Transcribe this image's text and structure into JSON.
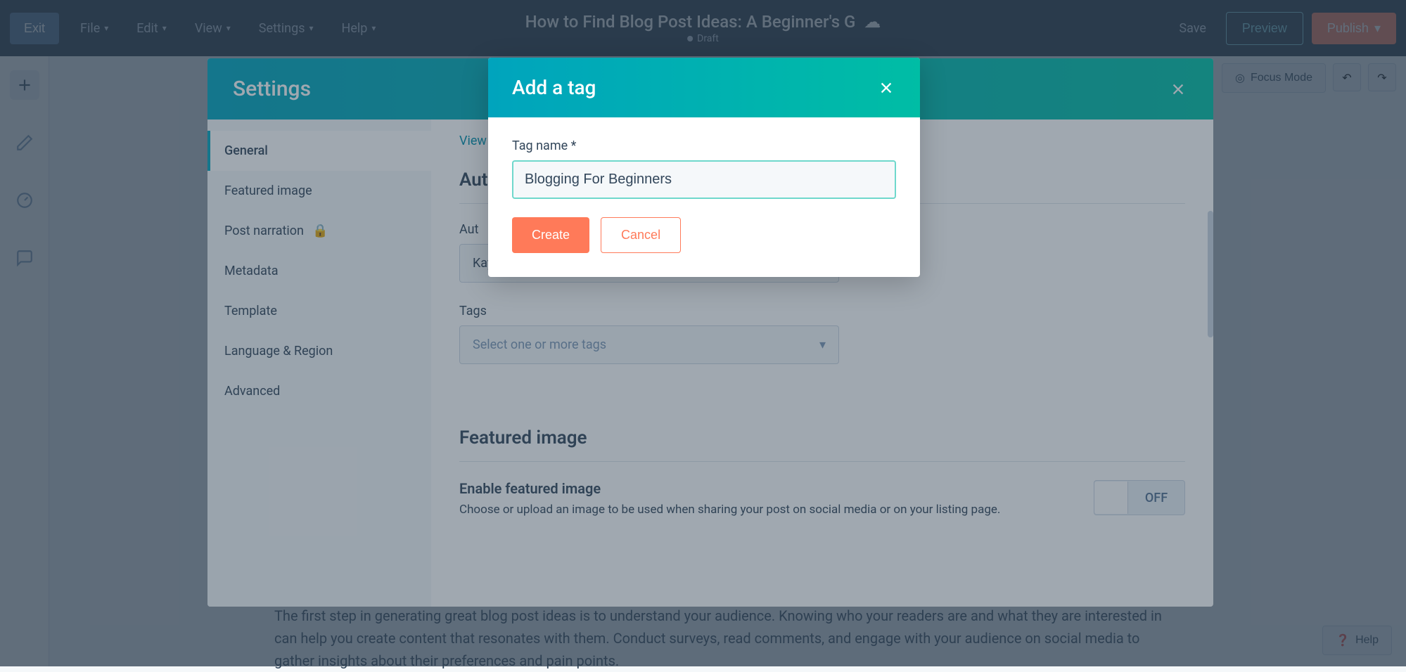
{
  "topbar": {
    "exit": "Exit",
    "menus": [
      "File",
      "Edit",
      "View",
      "Settings",
      "Help"
    ],
    "title": "How to Find Blog Post Ideas: A Beginner's G",
    "status": "Draft",
    "save": "Save",
    "preview": "Preview",
    "publish": "Publish"
  },
  "focus": {
    "label": "Focus Mode"
  },
  "editor": {
    "paragraph": "The first step in generating great blog post ideas is to understand your audience. Knowing who your readers are and what they are interested in can help you create content that resonates with them. Conduct surveys, read comments, and engage with your audience on social media to gather insights about their preferences and pain points."
  },
  "help": {
    "label": "Help"
  },
  "settings": {
    "title": "Settings",
    "nav": {
      "general": "General",
      "featured_image": "Featured image",
      "post_narration": "Post narration",
      "metadata": "Metadata",
      "template": "Template",
      "language_region": "Language & Region",
      "advanced": "Advanced"
    },
    "view_link": "View ",
    "authors_heading": "Auth",
    "author_label": "Aut",
    "author_value": "Kayla Ihrig",
    "tags_label": "Tags",
    "tags_placeholder": "Select one or more tags",
    "featured_heading": "Featured image",
    "featured_enable_title": "Enable featured image",
    "featured_enable_desc": "Choose or upload an image to be used when sharing your post on social media or on your listing page.",
    "toggle_off": "OFF"
  },
  "modal": {
    "title": "Add a tag",
    "label": "Tag name *",
    "value": "Blogging For Beginners",
    "create": "Create",
    "cancel": "Cancel"
  }
}
